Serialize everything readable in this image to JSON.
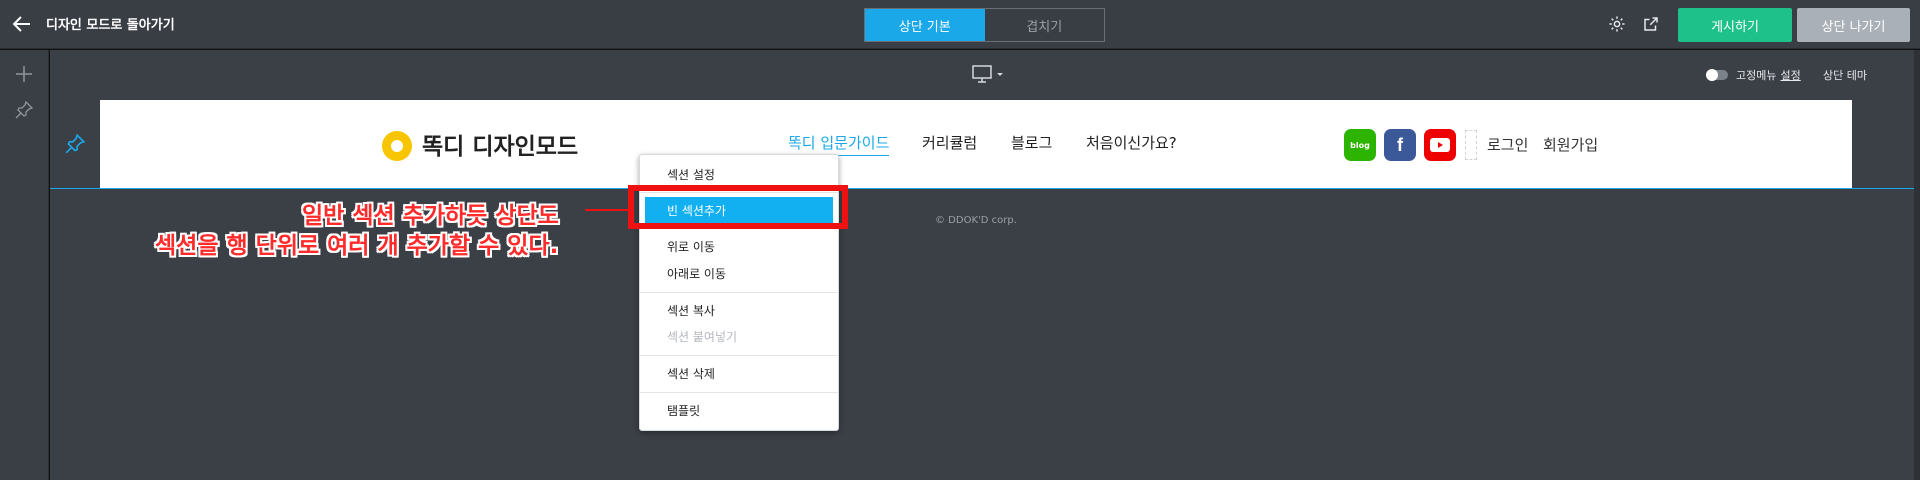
{
  "topbar": {
    "back_label": "디자인 모드로 돌아가기",
    "tabs": [
      {
        "label": "상단 기본",
        "active": true
      },
      {
        "label": "겹치기",
        "active": false
      }
    ],
    "publish_label": "게시하기",
    "exit_label": "상단 나가기"
  },
  "toolbar": {
    "fixed_menu_label": "고정메뉴",
    "fixed_menu_setting": "설정",
    "top_theme_label": "상단 테마"
  },
  "header": {
    "logo_text": "똑디 디자인모드",
    "nav": [
      {
        "label": "똑디 입문가이드",
        "active": true
      },
      {
        "label": "커리큘럼",
        "active": false
      },
      {
        "label": "블로그",
        "active": false
      },
      {
        "label": "처음이신가요?",
        "active": false
      }
    ],
    "social": {
      "blog": "blog",
      "facebook": "f"
    },
    "login_label": "로그인",
    "signup_label": "회원가입"
  },
  "footer": {
    "copyright": "© DDOK'D corp."
  },
  "context_menu": {
    "items": [
      {
        "label": "섹션 설정",
        "state": "normal"
      },
      {
        "label": "빈 섹션추가",
        "state": "highlight"
      },
      {
        "label": "위로 이동",
        "state": "normal"
      },
      {
        "label": "아래로 이동",
        "state": "normal"
      },
      {
        "label": "섹션 복사",
        "state": "normal"
      },
      {
        "label": "섹션 붙여넣기",
        "state": "disabled"
      },
      {
        "label": "섹션 삭제",
        "state": "normal"
      },
      {
        "label": "탬플릿",
        "state": "normal"
      }
    ]
  },
  "annotation": {
    "line1": "일반 섹션 추가하듯 상단도",
    "line2": "섹션을 행 단위로 여러 개 추가할 수 있다."
  },
  "colors": {
    "accent": "#1ba8e8",
    "publish": "#1fc18a",
    "annotation": "#ee1111"
  },
  "icons": {
    "back": "arrow-left-icon",
    "gear": "gear-icon",
    "external": "external-link-icon",
    "add": "plus-icon",
    "pin": "pin-icon",
    "device": "desktop-icon"
  }
}
